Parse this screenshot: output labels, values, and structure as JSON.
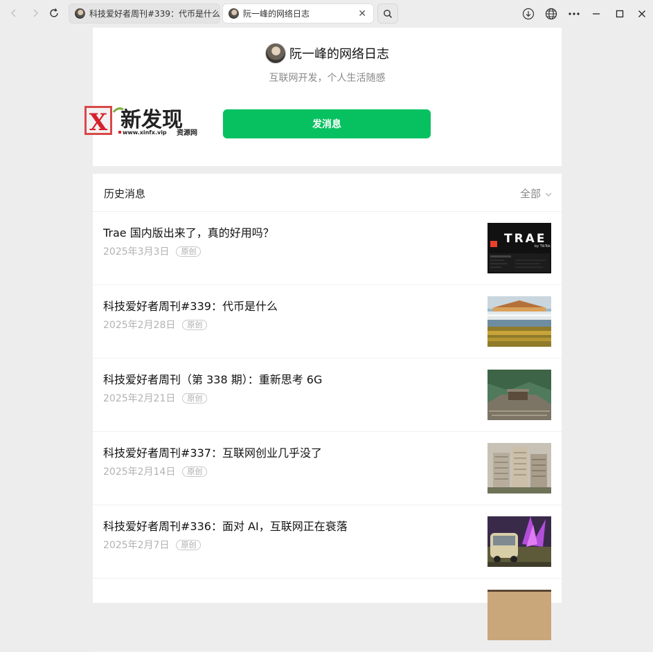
{
  "browser": {
    "tabs": [
      {
        "title": "科技爱好者周刊#339：代币是什么",
        "active": false
      },
      {
        "title": "阮一峰的网络日志",
        "active": true
      }
    ],
    "close_glyph": "✕",
    "icons": [
      "back-icon",
      "forward-icon",
      "reload-icon",
      "search-icon",
      "download-icon",
      "globe-icon",
      "more-icon",
      "minimize-icon",
      "maximize-icon",
      "close-icon"
    ]
  },
  "profile": {
    "name": "阮一峰的网络日志",
    "description": "互联网开发，个人生活随感",
    "send_label": "发消息"
  },
  "watermark": {
    "brand": "新发现",
    "url": "www.xinfx.vip",
    "sub": "资源网",
    "letter": "X"
  },
  "history": {
    "title": "历史消息",
    "filter_label": "全部",
    "articles": [
      {
        "title": "Trae 国内版出来了，真的好用吗？",
        "date": "2025年3月3日",
        "badge": "原创",
        "thumb_label": "TRAE",
        "thumb_sub": "by TikTok"
      },
      {
        "title": "科技爱好者周刊#339：代币是什么",
        "date": "2025年2月28日",
        "badge": "原创"
      },
      {
        "title": "科技爱好者周刊（第 338 期）：重新思考 6G",
        "date": "2025年2月21日",
        "badge": "原创"
      },
      {
        "title": "科技爱好者周刊#337：互联网创业几乎没了",
        "date": "2025年2月14日",
        "badge": "原创"
      },
      {
        "title": "科技爱好者周刊#336：面对 AI，互联网正在衰落",
        "date": "2025年2月7日",
        "badge": "原创"
      }
    ]
  },
  "colors": {
    "accent": "#07c160",
    "background": "#ededed",
    "card": "#ffffff"
  }
}
